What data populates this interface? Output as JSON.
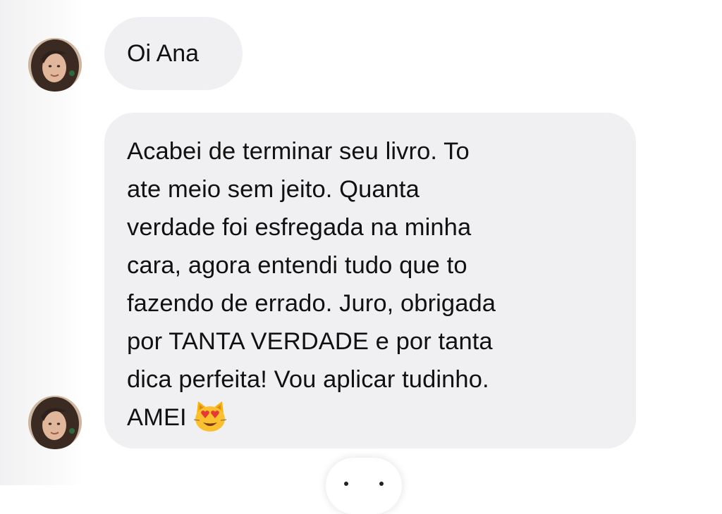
{
  "conversation": {
    "messages": [
      {
        "lines": [
          "Oi Ana"
        ]
      },
      {
        "lines": [
          "Acabei de terminar seu livro. To",
          "ate meio sem jeito. Quanta",
          "verdade foi esfregada na minha",
          "cara, agora entendi tudo que to",
          "fazendo de errado. Juro, obrigada",
          "por TANTA VERDADE e por tanta",
          "dica perfeita! Vou aplicar tudinho.",
          "AMEI"
        ],
        "emoji": "heart-eyes-cat-emoji"
      }
    ]
  },
  "colors": {
    "bubble_bg": "#f0f0f2",
    "text": "#111111",
    "background": "#ffffff"
  }
}
